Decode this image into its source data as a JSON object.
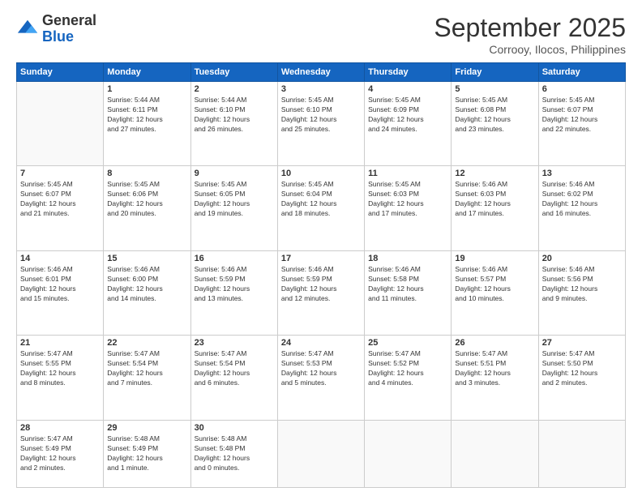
{
  "logo": {
    "general": "General",
    "blue": "Blue"
  },
  "header": {
    "month": "September 2025",
    "location": "Corrooy, Ilocos, Philippines"
  },
  "days_of_week": [
    "Sunday",
    "Monday",
    "Tuesday",
    "Wednesday",
    "Thursday",
    "Friday",
    "Saturday"
  ],
  "weeks": [
    [
      {
        "day": "",
        "info": ""
      },
      {
        "day": "1",
        "info": "Sunrise: 5:44 AM\nSunset: 6:11 PM\nDaylight: 12 hours\nand 27 minutes."
      },
      {
        "day": "2",
        "info": "Sunrise: 5:44 AM\nSunset: 6:10 PM\nDaylight: 12 hours\nand 26 minutes."
      },
      {
        "day": "3",
        "info": "Sunrise: 5:45 AM\nSunset: 6:10 PM\nDaylight: 12 hours\nand 25 minutes."
      },
      {
        "day": "4",
        "info": "Sunrise: 5:45 AM\nSunset: 6:09 PM\nDaylight: 12 hours\nand 24 minutes."
      },
      {
        "day": "5",
        "info": "Sunrise: 5:45 AM\nSunset: 6:08 PM\nDaylight: 12 hours\nand 23 minutes."
      },
      {
        "day": "6",
        "info": "Sunrise: 5:45 AM\nSunset: 6:07 PM\nDaylight: 12 hours\nand 22 minutes."
      }
    ],
    [
      {
        "day": "7",
        "info": "Sunrise: 5:45 AM\nSunset: 6:07 PM\nDaylight: 12 hours\nand 21 minutes."
      },
      {
        "day": "8",
        "info": "Sunrise: 5:45 AM\nSunset: 6:06 PM\nDaylight: 12 hours\nand 20 minutes."
      },
      {
        "day": "9",
        "info": "Sunrise: 5:45 AM\nSunset: 6:05 PM\nDaylight: 12 hours\nand 19 minutes."
      },
      {
        "day": "10",
        "info": "Sunrise: 5:45 AM\nSunset: 6:04 PM\nDaylight: 12 hours\nand 18 minutes."
      },
      {
        "day": "11",
        "info": "Sunrise: 5:45 AM\nSunset: 6:03 PM\nDaylight: 12 hours\nand 17 minutes."
      },
      {
        "day": "12",
        "info": "Sunrise: 5:46 AM\nSunset: 6:03 PM\nDaylight: 12 hours\nand 17 minutes."
      },
      {
        "day": "13",
        "info": "Sunrise: 5:46 AM\nSunset: 6:02 PM\nDaylight: 12 hours\nand 16 minutes."
      }
    ],
    [
      {
        "day": "14",
        "info": "Sunrise: 5:46 AM\nSunset: 6:01 PM\nDaylight: 12 hours\nand 15 minutes."
      },
      {
        "day": "15",
        "info": "Sunrise: 5:46 AM\nSunset: 6:00 PM\nDaylight: 12 hours\nand 14 minutes."
      },
      {
        "day": "16",
        "info": "Sunrise: 5:46 AM\nSunset: 5:59 PM\nDaylight: 12 hours\nand 13 minutes."
      },
      {
        "day": "17",
        "info": "Sunrise: 5:46 AM\nSunset: 5:59 PM\nDaylight: 12 hours\nand 12 minutes."
      },
      {
        "day": "18",
        "info": "Sunrise: 5:46 AM\nSunset: 5:58 PM\nDaylight: 12 hours\nand 11 minutes."
      },
      {
        "day": "19",
        "info": "Sunrise: 5:46 AM\nSunset: 5:57 PM\nDaylight: 12 hours\nand 10 minutes."
      },
      {
        "day": "20",
        "info": "Sunrise: 5:46 AM\nSunset: 5:56 PM\nDaylight: 12 hours\nand 9 minutes."
      }
    ],
    [
      {
        "day": "21",
        "info": "Sunrise: 5:47 AM\nSunset: 5:55 PM\nDaylight: 12 hours\nand 8 minutes."
      },
      {
        "day": "22",
        "info": "Sunrise: 5:47 AM\nSunset: 5:54 PM\nDaylight: 12 hours\nand 7 minutes."
      },
      {
        "day": "23",
        "info": "Sunrise: 5:47 AM\nSunset: 5:54 PM\nDaylight: 12 hours\nand 6 minutes."
      },
      {
        "day": "24",
        "info": "Sunrise: 5:47 AM\nSunset: 5:53 PM\nDaylight: 12 hours\nand 5 minutes."
      },
      {
        "day": "25",
        "info": "Sunrise: 5:47 AM\nSunset: 5:52 PM\nDaylight: 12 hours\nand 4 minutes."
      },
      {
        "day": "26",
        "info": "Sunrise: 5:47 AM\nSunset: 5:51 PM\nDaylight: 12 hours\nand 3 minutes."
      },
      {
        "day": "27",
        "info": "Sunrise: 5:47 AM\nSunset: 5:50 PM\nDaylight: 12 hours\nand 2 minutes."
      }
    ],
    [
      {
        "day": "28",
        "info": "Sunrise: 5:47 AM\nSunset: 5:49 PM\nDaylight: 12 hours\nand 2 minutes."
      },
      {
        "day": "29",
        "info": "Sunrise: 5:48 AM\nSunset: 5:49 PM\nDaylight: 12 hours\nand 1 minute."
      },
      {
        "day": "30",
        "info": "Sunrise: 5:48 AM\nSunset: 5:48 PM\nDaylight: 12 hours\nand 0 minutes."
      },
      {
        "day": "",
        "info": ""
      },
      {
        "day": "",
        "info": ""
      },
      {
        "day": "",
        "info": ""
      },
      {
        "day": "",
        "info": ""
      }
    ]
  ]
}
